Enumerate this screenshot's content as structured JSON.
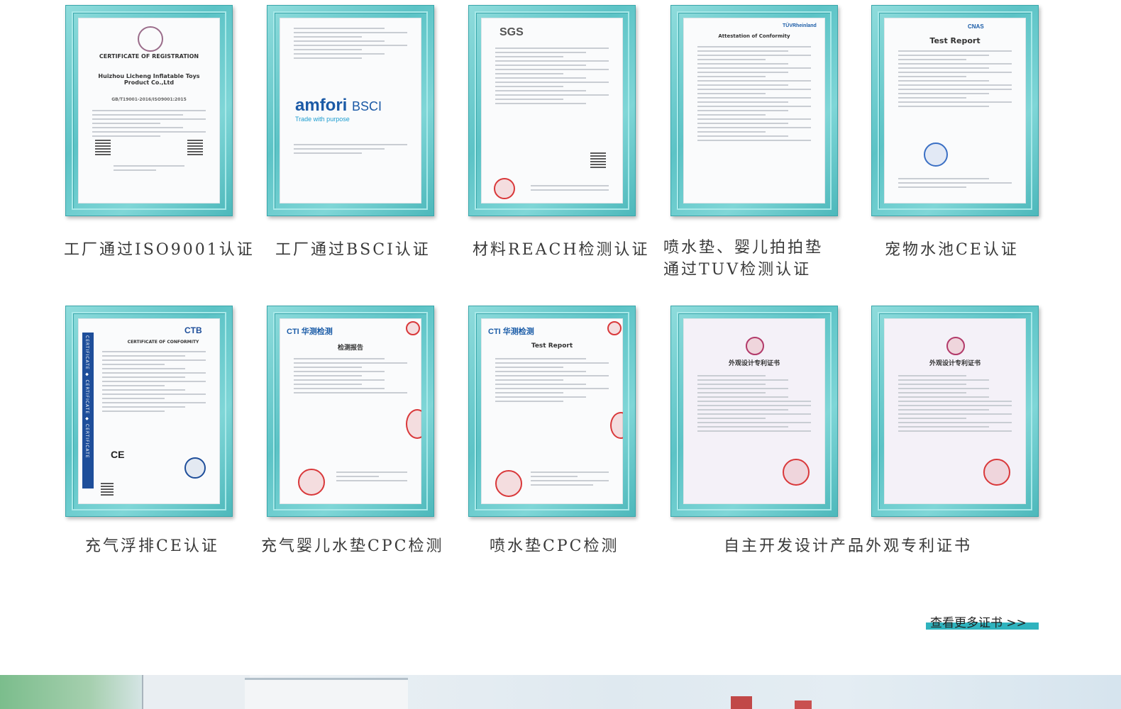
{
  "certificates": [
    {
      "caption": "工厂通过ISO9001认证",
      "paper_title": "CERTIFICATE OF REGISTRATION",
      "paper_company": "Huizhou Licheng Inflatable Toys Product Co.,Ltd",
      "paper_standard": "GB/T19001-2016/ISO9001:2015"
    },
    {
      "caption": "工厂通过BSCI认证",
      "logo": "amfori",
      "logo_suffix": "BSCI",
      "tagline": "Trade with purpose"
    },
    {
      "caption": "材料REACH检测认证",
      "logo": "SGS"
    },
    {
      "caption_line1": "喷水垫、婴儿拍拍垫",
      "caption_line2": "通过TUV检测认证",
      "paper_title": "Attestation of Conformity",
      "logo": "TÜVRheinland"
    },
    {
      "caption": "宠物水池CE认证",
      "paper_title": "Test Report",
      "logo": "CNAS"
    },
    {
      "caption": "充气浮排CE认证",
      "logo": "CTB",
      "paper_title": "CERTIFICATE OF CONFORMITY",
      "side_text": "CERTIFICATE ◆ CERTIFICATE ◆ CERTIFICATE",
      "mark": "CE"
    },
    {
      "caption": "充气婴儿水垫CPC检测",
      "logo": "CTI 华测检测",
      "paper_title": "检测报告"
    },
    {
      "caption": "喷水垫CPC检测",
      "logo": "CTI 华测检测",
      "paper_title": "Test Report"
    },
    {
      "paper_title": "外观设计专利证书"
    },
    {
      "paper_title": "外观设计专利证书"
    }
  ],
  "patent_caption": "自主开发设计产品外观专利证书",
  "more_link": "查看更多证书 >>",
  "colors": {
    "frame": "#5cc3c6",
    "link_bar": "#2fb3be",
    "seal": "#d9383a"
  }
}
